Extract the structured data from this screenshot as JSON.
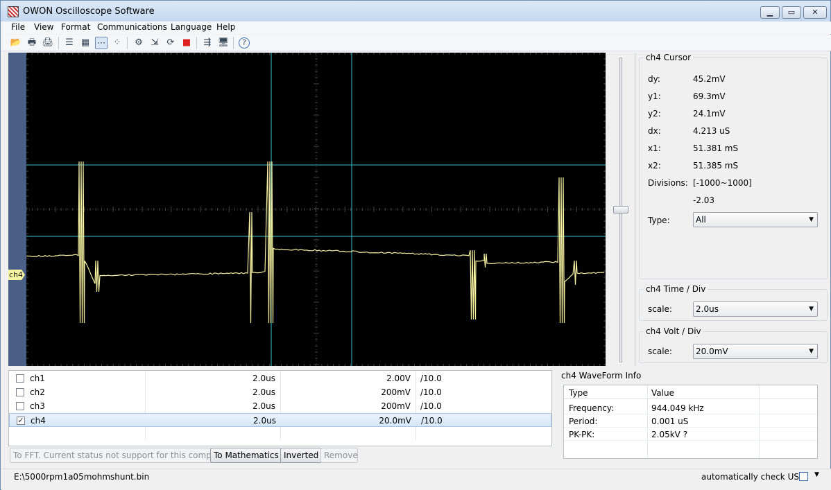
{
  "window": {
    "title": "OWON Oscilloscope Software",
    "min_glyph": "▁",
    "max_glyph": "▭",
    "close_glyph": "✕"
  },
  "menu": [
    "File",
    "View",
    "Format",
    "Communications",
    "Language",
    "Help"
  ],
  "toolbar": [
    {
      "icon": "open-folder-icon",
      "glyph": "📂"
    },
    {
      "icon": "print-icon",
      "glyph": "🖶"
    },
    {
      "icon": "print-preview-icon",
      "glyph": "🖨"
    },
    {
      "icon": "list-view-icon",
      "glyph": "☰"
    },
    {
      "icon": "grid-icon",
      "glyph": "▦"
    },
    {
      "icon": "cursor-lines-icon",
      "glyph": "⋯"
    },
    {
      "icon": "dots-icon",
      "glyph": "⁘"
    },
    {
      "icon": "settings-icon",
      "glyph": "⚙"
    },
    {
      "icon": "import-icon",
      "glyph": "⇲"
    },
    {
      "icon": "refresh-icon",
      "glyph": "⟳"
    },
    {
      "icon": "stop-icon",
      "glyph": "■"
    },
    {
      "icon": "export-icon",
      "glyph": "⇶"
    },
    {
      "icon": "monitor-icon",
      "glyph": "🖥"
    },
    {
      "icon": "help-icon",
      "glyph": "?"
    }
  ],
  "scope": {
    "channel_marker": "ch4",
    "grid_color": "#444444",
    "trace_color": "#f5f1a0",
    "cursor_color": "#38c4cc"
  },
  "cursor_panel": {
    "title": "ch4 Cursor",
    "rows": [
      {
        "label": "dy:",
        "value": "45.2mV"
      },
      {
        "label": "y1:",
        "value": "69.3mV"
      },
      {
        "label": "y2:",
        "value": "24.1mV"
      },
      {
        "label": "dx:",
        "value": "4.213 uS"
      },
      {
        "label": "x1:",
        "value": "51.381 mS"
      },
      {
        "label": "x2:",
        "value": "51.385 mS"
      },
      {
        "label": "Divisions:",
        "value": "[-1000~1000]"
      },
      {
        "label": "",
        "value": "-2.03"
      }
    ],
    "type_label": "Type:",
    "type_value": "All"
  },
  "time_panel": {
    "title": "ch4 Time / Div",
    "label": "scale:",
    "value": "2.0us"
  },
  "volt_panel": {
    "title": "ch4 Volt / Div",
    "label": "scale:",
    "value": "20.0mV"
  },
  "channels": [
    {
      "name": "ch1",
      "time": "2.0us",
      "volt": "2.00V",
      "probe": "/10.0",
      "checked": false
    },
    {
      "name": "ch2",
      "time": "2.0us",
      "volt": "200mV",
      "probe": "/10.0",
      "checked": false
    },
    {
      "name": "ch3",
      "time": "2.0us",
      "volt": "200mV",
      "probe": "/10.0",
      "checked": false
    },
    {
      "name": "ch4",
      "time": "2.0us",
      "volt": "20.0mV",
      "probe": "/10.0",
      "checked": true
    }
  ],
  "buttons": {
    "fft": "To FFT. Current status not support for this compute.",
    "math": "To Mathematics",
    "inverted": "Inverted",
    "remove": "Remove"
  },
  "waveform_info": {
    "title": "ch4 WaveForm Info",
    "headers": [
      "Type",
      "Value"
    ],
    "rows": [
      {
        "type": "Frequency:",
        "value": "944.049 kHz"
      },
      {
        "type": "Period:",
        "value": "0.001 uS"
      },
      {
        "type": "PK-PK:",
        "value": "2.05kV ?"
      }
    ]
  },
  "status": {
    "path": "E:\\5000rpm1a05mohmshunt.bin",
    "auto_usb": "automatically check USB:",
    "dropdown_glyph": "▼",
    "checkbox_glyph": "✓"
  }
}
